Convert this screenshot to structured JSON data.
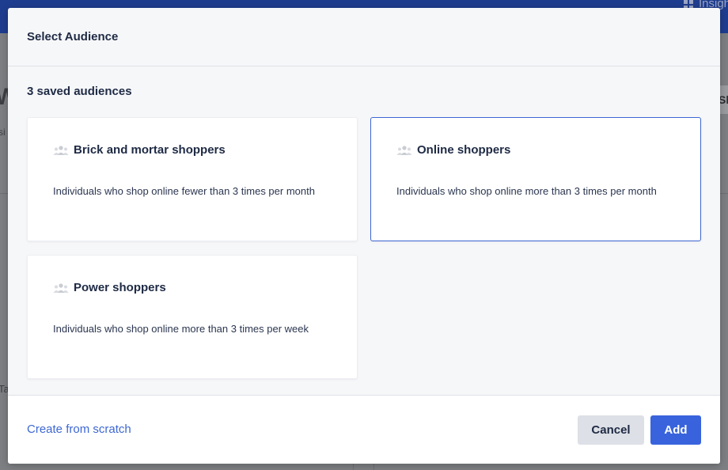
{
  "background": {
    "topbar_label": "Insights",
    "fragment_heading": "W",
    "fragment_sub": "si",
    "fragment_lower": "Ta",
    "fragment_right_button": "Sl"
  },
  "modal": {
    "title": "Select Audience",
    "section_title": "3 saved audiences",
    "audiences": [
      {
        "title": "Brick and mortar shoppers",
        "description": "Individuals who shop online fewer than 3 times per month",
        "icon": "people-icon",
        "selected": false
      },
      {
        "title": "Online shoppers",
        "description": "Individuals who shop online more than 3 times per month",
        "icon": "people-icon",
        "selected": true
      },
      {
        "title": "Power shoppers",
        "description": "Individuals who shop online more than 3 times per week",
        "icon": "people-icon",
        "selected": false
      }
    ],
    "footer": {
      "create_link": "Create from scratch",
      "cancel_label": "Cancel",
      "add_label": "Add"
    }
  },
  "colors": {
    "accent": "#3863dc",
    "selected_border": "#3d67d3",
    "text_dark": "#1e2a44",
    "topbar": "#1f3d8f"
  }
}
